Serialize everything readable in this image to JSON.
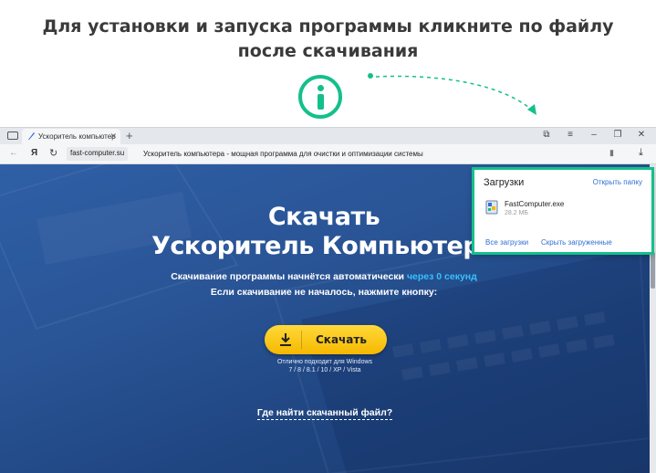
{
  "instruction": {
    "line1": "Для установки и запуска программы кликните по файлу",
    "line2": "после скачивания"
  },
  "browser": {
    "tab_title": "Ускоритель компьютер",
    "address_domain": "fast-computer.su",
    "address_title": "Ускоритель компьютера - мощная программа для очистки и оптимизации системы"
  },
  "site": {
    "title_line1": "Скачать",
    "title_line2": "Ускоритель Компьютера",
    "sub1_text": "Скачивание программы начнётся автоматически ",
    "sub1_timer": "через 0 секунд",
    "sub2": "Если скачивание не началось, нажмите кнопку:",
    "download_button": "Скачать",
    "compat_line1": "Отлично подходит для Windows",
    "compat_line2": "7 / 8 / 8.1 / 10 / XP / Vista",
    "where_link": "Где найти скачанный файл?"
  },
  "downloads_panel": {
    "title": "Загрузки",
    "open_folder": "Открыть папку",
    "file_name": "FastComputer.exe",
    "file_size": "28.2 МБ",
    "all_downloads": "Все загрузки",
    "hide_downloaded": "Скрыть загруженные"
  },
  "colors": {
    "accent_green": "#14c08a",
    "site_blue": "#2a5597",
    "button_yellow": "#ffd93a",
    "link_blue": "#2f6fd3",
    "timer_cyan": "#36c1ff"
  },
  "icons": [
    "info-icon",
    "tabs-icon",
    "tab-favicon",
    "close-icon",
    "new-tab-icon",
    "bookmarks-icon",
    "menu-icon",
    "minimize-icon",
    "restore-icon",
    "window-close-icon",
    "back-icon",
    "yandex-logo",
    "reload-icon",
    "bookmark-icon",
    "downloads-icon",
    "download-arrow-icon",
    "exe-file-icon"
  ]
}
